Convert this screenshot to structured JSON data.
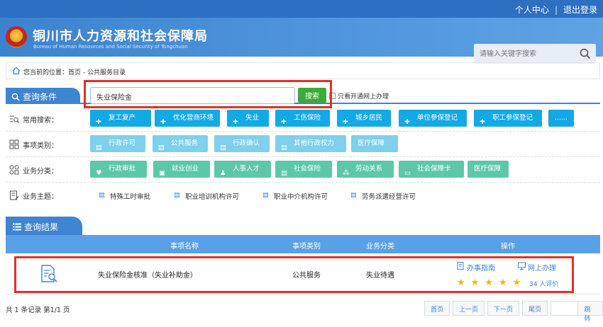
{
  "header": {
    "user_center": "个人中心",
    "logout": "退出登录",
    "brand_cn": "铜川市人力资源和社会保障局",
    "brand_en": "Bureau of Human Resources and Social Security of Tongchuan",
    "search_placeholder": "请输入关键字搜索"
  },
  "breadcrumb": {
    "prefix": "您当前的位置：",
    "path": "首页 - 公共服务目录"
  },
  "query": {
    "title": "查询条件",
    "input_value": "失业保险金",
    "search_button": "搜索",
    "online_only": "只看开通网上办理",
    "rows": [
      {
        "label": "常用搜索：",
        "tags": [
          "复工复产",
          "优化营商环境",
          "失业",
          "工伤保险",
          "城乡居民",
          "单位参保登记",
          "职工参保登记",
          "......"
        ]
      },
      {
        "label": "事项类别：",
        "tags": [
          "行政许可",
          "公共服务",
          "行政确认",
          "其他行政权力",
          "医疗保障"
        ]
      },
      {
        "label": "业务分类：",
        "tags": [
          "行政审批",
          "就业创业",
          "人事人才",
          "社会保险",
          "劳动关系",
          "社会保障卡",
          "医疗保障"
        ]
      },
      {
        "label": "业务主题：",
        "tags": [
          "特殊工时审批",
          "职业培训机构许可",
          "职业中介机构许可",
          "劳务派遣经营许可"
        ]
      }
    ]
  },
  "results": {
    "title": "查询结果",
    "columns": [
      "事项名称",
      "事项类别",
      "业务分类",
      "操作"
    ],
    "rows": [
      {
        "name": "失业保险金核准（失业补助金）",
        "category": "公共服务",
        "business": "失业待遇",
        "guide": "办事指南",
        "online": "网上办理",
        "stars": 5,
        "rating": "34 人评价"
      }
    ]
  },
  "footer": {
    "summary": "共 1 条记录 第1/1 页",
    "first": "首页",
    "prev": "上一页",
    "next": "下一页",
    "last": "尾页",
    "go": "跳转"
  },
  "colors": {
    "primary": "#3f84d0",
    "tag_common": "#12a9e6",
    "tag_category": "#7ed0ec",
    "tag_business": "#5ec7a8",
    "search_green": "#3aab3a",
    "highlight_red": "#e0302a",
    "star": "#f3b414"
  }
}
